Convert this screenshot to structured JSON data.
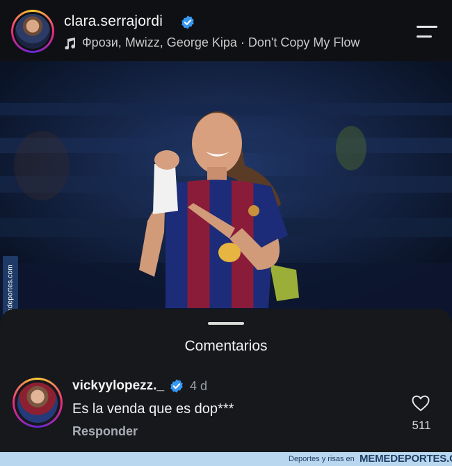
{
  "header": {
    "username": "clara.serrajordi",
    "verified_icon": "verified-badge-icon",
    "music_icon": "music-note-icon",
    "audio_track": "Фрози, Mwizz, George Kipa · Don't Copy My Flow",
    "menu_icon": "menu-lines-icon"
  },
  "photo": {
    "side_watermark": "Memedeportes.com"
  },
  "comments": {
    "title": "Comentarios",
    "items": [
      {
        "username": "vickyylopezz._",
        "time": "4 d",
        "text": "Es la venda que es dop***",
        "reply_label": "Responder",
        "likes": "511"
      }
    ]
  },
  "footer": {
    "tagline": "Deportes y risas en",
    "brand": "MEMEDEPORTES.COM"
  },
  "colors": {
    "background": "#0e1013",
    "sheet": "#16181c",
    "verified_blue": "#3897f0",
    "footer_bg": "#b9d7ee",
    "footer_text": "#1d3f66"
  }
}
